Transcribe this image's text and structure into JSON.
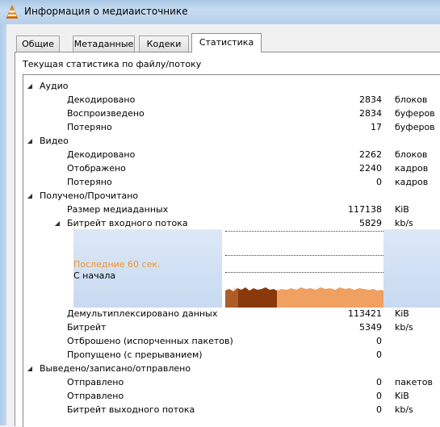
{
  "window": {
    "title": "Информация о медиаисточнике",
    "icon": "vlc-cone-icon"
  },
  "tabs": [
    {
      "label": "Общие",
      "active": false
    },
    {
      "label": "Метаданные",
      "active": false
    },
    {
      "label": "Кодеки",
      "active": false
    },
    {
      "label": "Статистика",
      "active": true
    }
  ],
  "page": {
    "caption": "Текущая статистика по файлу/потоку"
  },
  "tree": {
    "audio": {
      "label": "Аудио",
      "decoded": {
        "label": "Декодировано",
        "value": "2834",
        "unit": "блоков"
      },
      "played": {
        "label": "Воспроизведено",
        "value": "2834",
        "unit": "буферов"
      },
      "lost": {
        "label": "Потеряно",
        "value": "17",
        "unit": "буферов"
      }
    },
    "video": {
      "label": "Видео",
      "decoded": {
        "label": "Декодировано",
        "value": "2262",
        "unit": "блоков"
      },
      "displayed": {
        "label": "Отображено",
        "value": "2240",
        "unit": "кадров"
      },
      "lost": {
        "label": "Потеряно",
        "value": "0",
        "unit": "кадров"
      }
    },
    "input": {
      "label": "Получено/Прочитано",
      "media_size": {
        "label": "Размер медиаданных",
        "value": "117138",
        "unit": "KiB"
      },
      "input_bitrate": {
        "label": "Битрейт входного потока",
        "value": "5829",
        "unit": "kb/s"
      },
      "graph": {
        "legend_last": "Последние 60 сек.",
        "legend_start": "С начала",
        "legend_last_color": "#f0922c",
        "fill_last_color": "#f0a060",
        "fill_start_color": "#8a3a0a"
      },
      "demuxed": {
        "label": "Демультиплексировано данных",
        "value": "113421",
        "unit": "KiB"
      },
      "bitrate": {
        "label": "Битрейт",
        "value": "5349",
        "unit": "kb/s"
      },
      "discarded": {
        "label": "Отброшено (испорченных пакетов)",
        "value": "0",
        "unit": ""
      },
      "dropped": {
        "label": "Пропущено (с прерыванием)",
        "value": "0",
        "unit": ""
      }
    },
    "output": {
      "label": "Выведено/записано/отправлено",
      "sent_packets": {
        "label": "Отправлено",
        "value": "0",
        "unit": "пакетов"
      },
      "sent_kib": {
        "label": "Отправлено",
        "value": "0",
        "unit": "KiB"
      },
      "output_bitrate": {
        "label": "Битрейт выходного потока",
        "value": "0",
        "unit": "kb/s"
      }
    }
  }
}
